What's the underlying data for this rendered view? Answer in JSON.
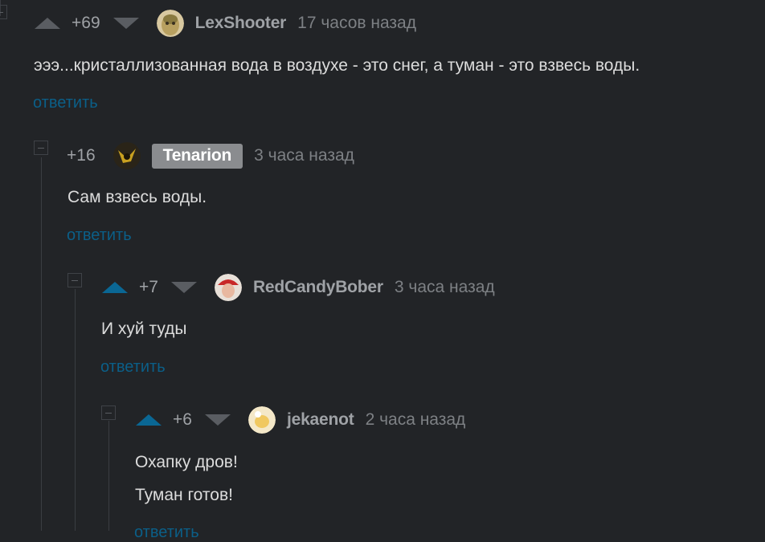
{
  "comments": [
    {
      "rating": "+69",
      "user": "LexShooter",
      "time": "17 часов назад",
      "lines": [
        "эээ...кристаллизованная вода в воздухе - это снег, а туман - это взвесь воды."
      ],
      "reply": "ответить"
    },
    {
      "rating": "+16",
      "user": "Tenarion",
      "time": "3 часа назад",
      "lines": [
        "Сам взвесь воды."
      ],
      "reply": "ответить"
    },
    {
      "rating": "+7",
      "user": "RedCandyBober",
      "time": "3 часа назад",
      "lines": [
        "И хуй туды"
      ],
      "reply": "ответить"
    },
    {
      "rating": "+6",
      "user": "jekaenot",
      "time": "2 часа назад",
      "lines": [
        "Охапку дров!",
        "Туман готов!"
      ],
      "reply": "ответить"
    }
  ],
  "colors": {
    "accent": "#0a6794",
    "background": "#222427",
    "muted": "#5a5d62"
  }
}
